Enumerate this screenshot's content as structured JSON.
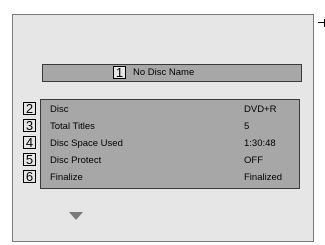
{
  "title": {
    "number": "1",
    "text": "No Disc Name"
  },
  "rows": [
    {
      "number": "2",
      "label": "Disc",
      "value": "DVD+R"
    },
    {
      "number": "3",
      "label": "Total Titles",
      "value": "5"
    },
    {
      "number": "4",
      "label": "Disc Space Used",
      "value": "1:30:48"
    },
    {
      "number": "5",
      "label": "Disc Protect",
      "value": "OFF"
    },
    {
      "number": "6",
      "label": "Finalize",
      "value": "Finalized"
    }
  ],
  "icons": {
    "scroll_down": "down-arrow-icon"
  }
}
